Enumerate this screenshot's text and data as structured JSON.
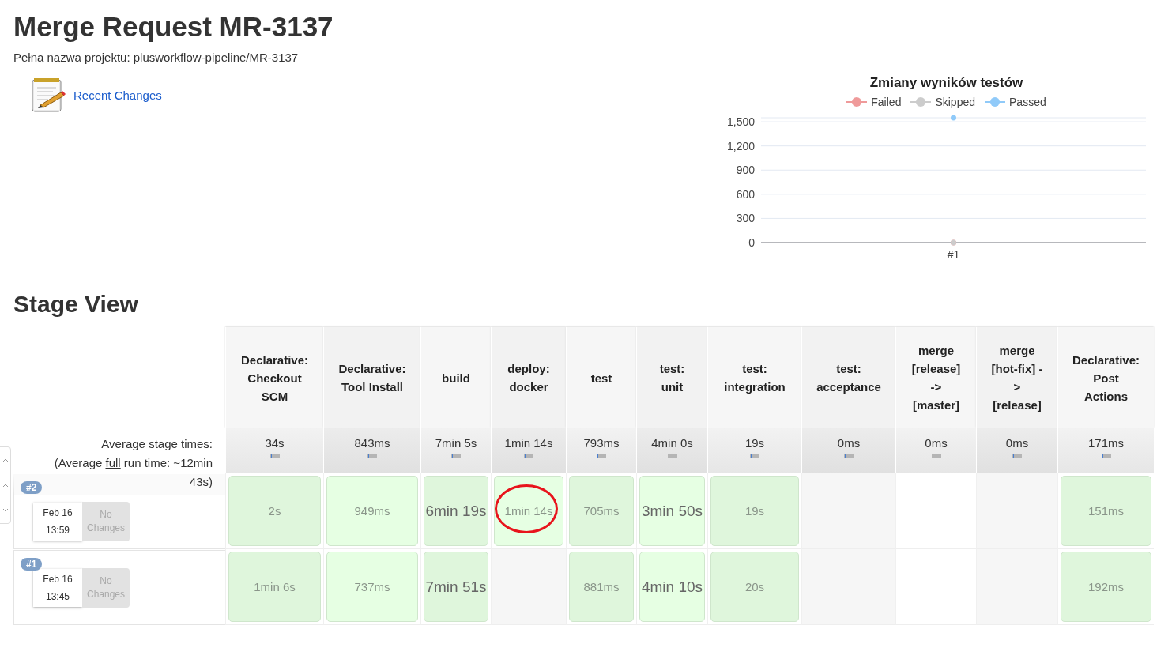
{
  "page": {
    "title": "Merge Request MR-3137",
    "full_name": "Pełna nazwa projektu: plusworkflow-pipeline/MR-3137"
  },
  "links": [
    {
      "label": "Recent Changes"
    }
  ],
  "test_chart": {
    "chart_data": {
      "type": "line",
      "title": "Zmiany wyników testów",
      "categories": [
        "#1"
      ],
      "legend": "top",
      "series": [
        {
          "name": "Failed",
          "color": "#ef9a9a",
          "marker": "circle",
          "values": [
            0
          ]
        },
        {
          "name": "Skipped",
          "color": "#cccccc",
          "marker": "circle",
          "values": [
            0
          ]
        },
        {
          "name": "Passed",
          "color": "#90caf9",
          "marker": "circle",
          "values": [
            1550
          ]
        }
      ],
      "ylim": [
        0,
        1550
      ],
      "grid": true,
      "yticks": [
        {
          "value": 0,
          "label": "0"
        },
        {
          "value": 300,
          "label": "300"
        },
        {
          "value": 600,
          "label": "600"
        },
        {
          "value": 900,
          "label": "900"
        },
        {
          "value": 1200,
          "label": "1,200"
        },
        {
          "value": 1500,
          "label": "1,500"
        }
      ]
    }
  },
  "stage_view": {
    "title": "Stage View",
    "stages": [
      {
        "name": "Declarative: Checkout SCM",
        "average": "34s"
      },
      {
        "name": "Declarative: Tool Install",
        "average": "843ms"
      },
      {
        "name": "build",
        "average": "7min 5s"
      },
      {
        "name": "deploy: docker",
        "average": "1min 14s"
      },
      {
        "name": "test",
        "average": "793ms"
      },
      {
        "name": "test: unit",
        "average": "4min 0s"
      },
      {
        "name": "test: integration",
        "average": "19s"
      },
      {
        "name": "test: acceptance",
        "average": "0ms"
      },
      {
        "name": "merge [release] -> [master]",
        "average": "0ms"
      },
      {
        "name": "merge [hot-fix] -> [release]",
        "average": "0ms"
      },
      {
        "name": "Declarative: Post Actions",
        "average": "171ms"
      }
    ],
    "average_label": "Average stage times:",
    "full_run": {
      "before": "(Average ",
      "link": "full",
      "after": " run time: ~12min 43s)"
    },
    "builds": [
      {
        "number": "#2",
        "date": "Feb 16",
        "time": "13:59",
        "changes": "No Changes",
        "cells": [
          {
            "kind": "success",
            "duration": "2s",
            "emphasis": false,
            "highlighted": false
          },
          {
            "kind": "success",
            "duration": "949ms",
            "emphasis": false,
            "highlighted": false
          },
          {
            "kind": "success",
            "duration": "6min 19s",
            "emphasis": true,
            "highlighted": false
          },
          {
            "kind": "success",
            "duration": "1min 14s",
            "emphasis": false,
            "highlighted": true
          },
          {
            "kind": "success",
            "duration": "705ms",
            "emphasis": false,
            "highlighted": false
          },
          {
            "kind": "success",
            "duration": "3min 50s",
            "emphasis": true,
            "highlighted": false
          },
          {
            "kind": "success",
            "duration": "19s",
            "emphasis": false,
            "highlighted": false
          },
          {
            "kind": "empty"
          },
          {
            "kind": "empty"
          },
          {
            "kind": "empty"
          },
          {
            "kind": "success",
            "duration": "151ms",
            "emphasis": false,
            "highlighted": false
          }
        ]
      },
      {
        "number": "#1",
        "date": "Feb 16",
        "time": "13:45",
        "changes": "No Changes",
        "cells": [
          {
            "kind": "success",
            "duration": "1min 6s",
            "emphasis": false,
            "highlighted": false
          },
          {
            "kind": "success",
            "duration": "737ms",
            "emphasis": false,
            "highlighted": false
          },
          {
            "kind": "success",
            "duration": "7min 51s",
            "emphasis": true,
            "highlighted": false
          },
          {
            "kind": "empty"
          },
          {
            "kind": "success",
            "duration": "881ms",
            "emphasis": false,
            "highlighted": false
          },
          {
            "kind": "success",
            "duration": "4min 10s",
            "emphasis": true,
            "highlighted": false
          },
          {
            "kind": "success",
            "duration": "20s",
            "emphasis": false,
            "highlighted": false
          },
          {
            "kind": "empty"
          },
          {
            "kind": "empty"
          },
          {
            "kind": "empty"
          },
          {
            "kind": "success",
            "duration": "192ms",
            "emphasis": false,
            "highlighted": false
          }
        ]
      }
    ]
  }
}
